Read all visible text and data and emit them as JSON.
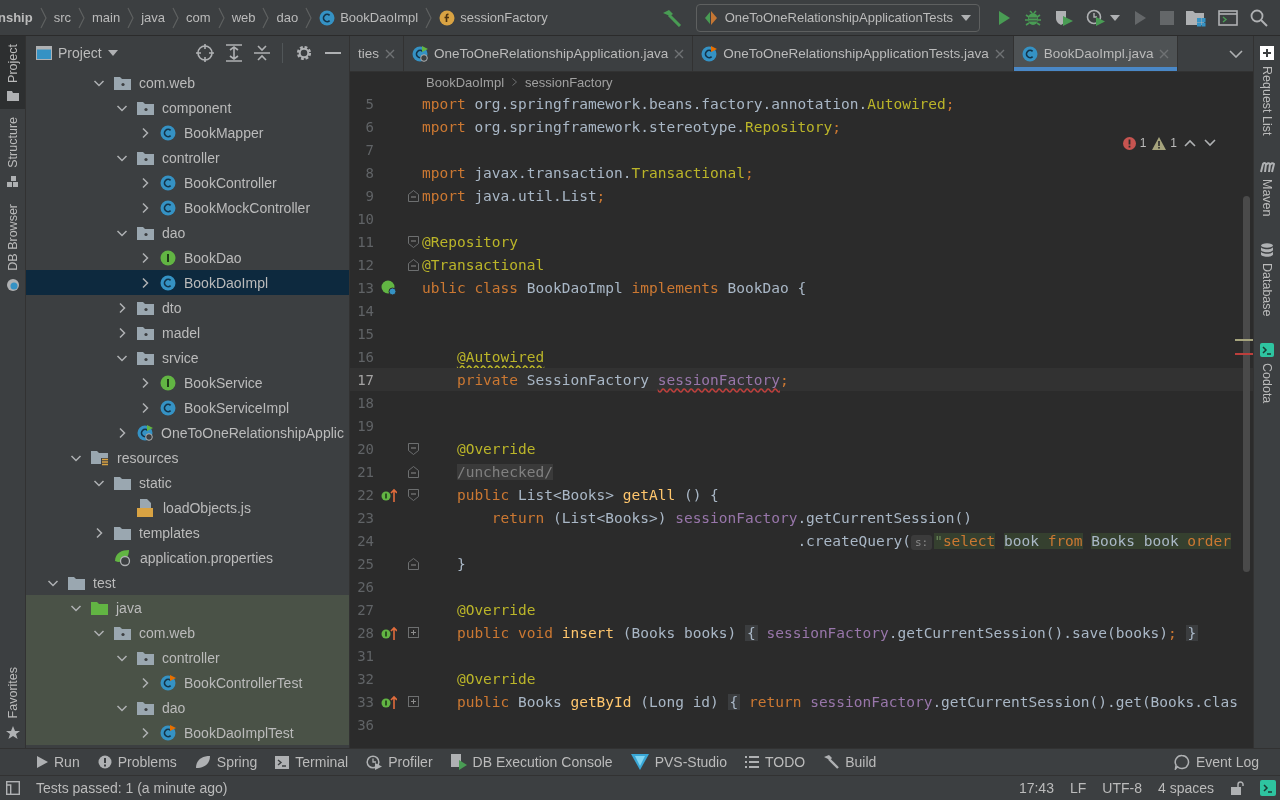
{
  "nav_bar": {
    "breadcrumbs": [
      {
        "label": "nship",
        "kind": "project"
      },
      {
        "label": "src",
        "kind": "dir"
      },
      {
        "label": "main",
        "kind": "dir"
      },
      {
        "label": "java",
        "kind": "dir"
      },
      {
        "label": "com",
        "kind": "dir"
      },
      {
        "label": "web",
        "kind": "dir"
      },
      {
        "label": "dao",
        "kind": "dir"
      },
      {
        "label": "BookDaoImpl",
        "kind": "class"
      },
      {
        "label": "sessionFactory",
        "kind": "field"
      }
    ],
    "run_config": "OneToOneRelationshipApplicationTests",
    "actions": [
      {
        "kind": "run",
        "disabled": false
      },
      {
        "kind": "debug",
        "disabled": false
      },
      {
        "kind": "coverage",
        "disabled": false
      },
      {
        "kind": "profile",
        "disabled": false
      },
      {
        "kind": "rerun",
        "disabled": true
      },
      {
        "kind": "stop",
        "disabled": true
      },
      {
        "kind": "structure",
        "disabled": false
      },
      {
        "kind": "layout",
        "disabled": false
      },
      {
        "kind": "search",
        "disabled": false
      }
    ]
  },
  "left_strip": {
    "top": [
      {
        "label": "Project",
        "kind": "project",
        "selected": true
      },
      {
        "label": "Structure",
        "kind": "structure",
        "selected": false
      },
      {
        "label": "DB Browser",
        "kind": "db",
        "selected": false
      }
    ],
    "bottom": [
      {
        "label": "Favorites",
        "kind": "favorites",
        "selected": false
      }
    ]
  },
  "project_panel": {
    "title": "Project",
    "tree": [
      {
        "children": [
          {
            "children": [
              {
                "label": "com.web",
                "kind": "package",
                "expanded": true,
                "selected": false,
                "children": [
                  {
                    "label": "component",
                    "kind": "package",
                    "expanded": true,
                    "selected": false,
                    "children": [
                      {
                        "label": "BookMapper",
                        "kind": "class",
                        "expanded": false,
                        "selected": false
                      }
                    ]
                  },
                  {
                    "label": "controller",
                    "kind": "package",
                    "expanded": true,
                    "selected": false,
                    "children": [
                      {
                        "label": "BookController",
                        "kind": "class",
                        "expanded": false,
                        "selected": false
                      },
                      {
                        "label": "BookMockController",
                        "kind": "class",
                        "expanded": false,
                        "selected": false
                      }
                    ]
                  },
                  {
                    "label": "dao",
                    "kind": "package",
                    "expanded": true,
                    "selected": false,
                    "children": [
                      {
                        "label": "BookDao",
                        "kind": "interface",
                        "expanded": false,
                        "selected": false
                      },
                      {
                        "label": "BookDaoImpl",
                        "kind": "class",
                        "expanded": false,
                        "selected": true
                      }
                    ]
                  },
                  {
                    "label": "dto",
                    "kind": "package",
                    "expanded": false,
                    "selected": false
                  },
                  {
                    "label": "madel",
                    "kind": "package",
                    "expanded": false,
                    "selected": false
                  },
                  {
                    "label": "srvice",
                    "kind": "package",
                    "expanded": true,
                    "selected": false,
                    "children": [
                      {
                        "label": "BookService",
                        "kind": "interface",
                        "expanded": false,
                        "selected": false
                      },
                      {
                        "label": "BookServiceImpl",
                        "kind": "class",
                        "expanded": false,
                        "selected": false
                      }
                    ]
                  },
                  {
                    "label": "OneToOneRelationshipApplic",
                    "kind": "app",
                    "expanded": false,
                    "selected": false
                  }
                ]
              }
            ]
          },
          {
            "label": "resources",
            "kind": "resources",
            "expanded": true,
            "selected": false,
            "children": [
              {
                "label": "static",
                "kind": "folder",
                "expanded": true,
                "selected": false,
                "children": [
                  {
                    "label": "loadObjects.js",
                    "kind": "js",
                    "selected": false
                  }
                ]
              },
              {
                "label": "templates",
                "kind": "folder",
                "expanded": false,
                "selected": false
              },
              {
                "label": "application.properties",
                "kind": "properties",
                "selected": false
              }
            ]
          }
        ]
      },
      {
        "label": "test",
        "kind": "folder",
        "expanded": true,
        "selected": false,
        "children": [
          {
            "label": "java",
            "kind": "test-root",
            "expanded": true,
            "selected": false,
            "children": [
              {
                "label": "com.web",
                "kind": "package",
                "expanded": true,
                "selected": false,
                "children": [
                  {
                    "label": "controller",
                    "kind": "package",
                    "expanded": true,
                    "selected": false,
                    "children": [
                      {
                        "label": "BookControllerTest",
                        "kind": "test-class",
                        "expanded": false,
                        "selected": false
                      }
                    ]
                  },
                  {
                    "label": "dao",
                    "kind": "package",
                    "expanded": true,
                    "selected": false,
                    "children": [
                      {
                        "label": "BookDaoImplTest",
                        "kind": "test-class",
                        "expanded": false,
                        "selected": false
                      }
                    ]
                  }
                ]
              }
            ]
          }
        ]
      }
    ]
  },
  "editor": {
    "tabs": [
      {
        "label": "ties",
        "selected": false
      },
      {
        "label": "OneToOneRelationshipApplication.java",
        "kind": "app",
        "selected": false
      },
      {
        "label": "OneToOneRelationshipApplicationTests.java",
        "kind": "test-class",
        "selected": false
      },
      {
        "label": "BookDaoImpl.java",
        "kind": "class",
        "selected": true
      }
    ],
    "breadcrumb": [
      "BookDaoImpl",
      "sessionFactory"
    ],
    "inspections": {
      "errors": "1",
      "warnings": "1"
    },
    "lines": [
      {
        "number": "5",
        "current": false,
        "tokens": [
          {
            "text": "mport ",
            "kind": "kw"
          },
          {
            "text": "org.springframework.beans.factory.annotation.",
            "kind": "plain"
          },
          {
            "text": "Autowired",
            "kind": "ann"
          },
          {
            "text": ";",
            "kind": "kw"
          }
        ]
      },
      {
        "number": "6",
        "current": false,
        "tokens": [
          {
            "text": "mport ",
            "kind": "kw"
          },
          {
            "text": "org.springframework.stereotype.",
            "kind": "plain"
          },
          {
            "text": "Repository",
            "kind": "ann"
          },
          {
            "text": ";",
            "kind": "kw"
          }
        ]
      },
      {
        "number": "7",
        "current": false
      },
      {
        "number": "8",
        "current": false,
        "tokens": [
          {
            "text": "mport ",
            "kind": "kw"
          },
          {
            "text": "javax.transaction.",
            "kind": "plain"
          },
          {
            "text": "Transactional",
            "kind": "ann"
          },
          {
            "text": ";",
            "kind": "kw"
          }
        ]
      },
      {
        "number": "9",
        "current": false,
        "markers": [
          {
            "kind": "fold-end"
          }
        ],
        "tokens": [
          {
            "text": "mport ",
            "kind": "kw"
          },
          {
            "text": "java.util.List",
            "kind": "plain"
          },
          {
            "text": ";",
            "kind": "kw"
          }
        ]
      },
      {
        "number": "10",
        "current": false
      },
      {
        "number": "11",
        "current": false,
        "markers": [
          {
            "kind": "fold-start"
          }
        ],
        "tokens": [
          {
            "text": "@Repository",
            "kind": "ann"
          }
        ]
      },
      {
        "number": "12",
        "current": false,
        "markers": [
          {
            "kind": "fold-end"
          }
        ],
        "tokens": [
          {
            "text": "@Transactional",
            "kind": "ann"
          }
        ]
      },
      {
        "number": "13",
        "current": false,
        "markers": [
          {
            "kind": "bean"
          }
        ],
        "tokens": [
          {
            "text": "ublic class ",
            "kind": "kw"
          },
          {
            "text": "BookDaoImpl ",
            "kind": "plain"
          },
          {
            "text": "implements ",
            "kind": "kw"
          },
          {
            "text": "BookDao {",
            "kind": "plain"
          }
        ]
      },
      {
        "number": "14",
        "current": false
      },
      {
        "number": "15",
        "current": false
      },
      {
        "number": "16",
        "current": false,
        "tokens": [
          {
            "text": "    @Autowired",
            "kind": "ann-warn"
          }
        ]
      },
      {
        "number": "17",
        "current": true,
        "tokens": [
          {
            "text": "    private ",
            "kind": "kw"
          },
          {
            "text": "SessionFactory ",
            "kind": "plain"
          },
          {
            "text": "sessionFactory",
            "kind": "field-err"
          },
          {
            "text": ";",
            "kind": "kw"
          }
        ]
      },
      {
        "number": "18",
        "current": false
      },
      {
        "number": "19",
        "current": false
      },
      {
        "number": "20",
        "current": false,
        "markers": [
          {
            "kind": "fold-start"
          }
        ],
        "tokens": [
          {
            "text": "    @Override",
            "kind": "ann"
          }
        ]
      },
      {
        "number": "21",
        "current": false,
        "markers": [
          {
            "kind": "fold-end"
          }
        ],
        "tokens": [
          {
            "text": "    /unchecked/",
            "kind": "comment"
          }
        ]
      },
      {
        "number": "22",
        "current": false,
        "markers": [
          {
            "kind": "implements"
          },
          {
            "kind": "fold-start"
          }
        ],
        "tokens": [
          {
            "text": "    public ",
            "kind": "kw"
          },
          {
            "text": "List<Books> ",
            "kind": "plain"
          },
          {
            "text": "getAll",
            "kind": "method"
          },
          {
            "text": " () {",
            "kind": "plain"
          }
        ]
      },
      {
        "number": "23",
        "current": false,
        "tokens": [
          {
            "text": "        return ",
            "kind": "kw"
          },
          {
            "text": "(List<Books>) ",
            "kind": "plain"
          },
          {
            "text": "sessionFactory",
            "kind": "field"
          },
          {
            "text": ".getCurrentSession()",
            "kind": "plain"
          }
        ]
      },
      {
        "number": "24",
        "current": false,
        "tokens": [
          {
            "text": "                                           .createQuery(",
            "kind": "plain"
          },
          {
            "text": "s:",
            "kind": "hint"
          },
          {
            "text": "\"",
            "kind": "quote"
          },
          {
            "text": "select",
            "kind": "sql-kw"
          },
          {
            "text": " book ",
            "kind": "sql"
          },
          {
            "text": "from",
            "kind": "sql-kw"
          },
          {
            "text": " Books book ",
            "kind": "sql"
          },
          {
            "text": "order",
            "kind": "sql-kw"
          }
        ]
      },
      {
        "number": "25",
        "current": false,
        "markers": [
          {
            "kind": "fold-end"
          }
        ],
        "tokens": [
          {
            "text": "    }",
            "kind": "plain"
          }
        ]
      },
      {
        "number": "26",
        "current": false
      },
      {
        "number": "27",
        "current": false,
        "tokens": [
          {
            "text": "    @Override",
            "kind": "ann"
          }
        ]
      },
      {
        "number": "28",
        "current": false,
        "markers": [
          {
            "kind": "implements"
          },
          {
            "kind": "fold-collapsed"
          }
        ],
        "tokens": [
          {
            "text": "    public void ",
            "kind": "kw"
          },
          {
            "text": "insert",
            "kind": "method"
          },
          {
            "text": " (Books books) ",
            "kind": "plain"
          },
          {
            "text": "{",
            "kind": "folded"
          },
          {
            "text": " sessionFactory",
            "kind": "field"
          },
          {
            "text": ".getCurrentSession().save(books)",
            "kind": "plain"
          },
          {
            "text": ";",
            "kind": "kw"
          },
          {
            "text": " }",
            "kind": "folded"
          }
        ]
      },
      {
        "number": "31",
        "current": false
      },
      {
        "number": "32",
        "current": false,
        "tokens": [
          {
            "text": "    @Override",
            "kind": "ann"
          }
        ]
      },
      {
        "number": "33",
        "current": false,
        "markers": [
          {
            "kind": "implements"
          },
          {
            "kind": "fold-collapsed"
          }
        ],
        "tokens": [
          {
            "text": "    public ",
            "kind": "kw"
          },
          {
            "text": "Books ",
            "kind": "plain"
          },
          {
            "text": "getById",
            "kind": "method"
          },
          {
            "text": " (Long id) ",
            "kind": "plain"
          },
          {
            "text": "{",
            "kind": "folded"
          },
          {
            "text": " return ",
            "kind": "kw"
          },
          {
            "text": "sessionFactory",
            "kind": "field"
          },
          {
            "text": ".getCurrentSession().get(Books.clas",
            "kind": "plain"
          }
        ]
      },
      {
        "number": "36",
        "current": false
      }
    ]
  },
  "right_strip": [
    {
      "label": "Request List",
      "kind": "request"
    },
    {
      "label": "Maven",
      "kind": "maven"
    },
    {
      "label": "Database",
      "kind": "database"
    },
    {
      "label": "Codota",
      "kind": "codota"
    }
  ],
  "tool_windows": {
    "left": [
      {
        "label": "Run",
        "kind": "run"
      },
      {
        "label": "Problems",
        "kind": "problems"
      },
      {
        "label": "Spring",
        "kind": "spring"
      },
      {
        "label": "Terminal",
        "kind": "terminal"
      },
      {
        "label": "Profiler",
        "kind": "profiler"
      },
      {
        "label": "DB Execution Console",
        "kind": "db"
      },
      {
        "label": "PVS-Studio",
        "kind": "pvs"
      },
      {
        "label": "TODO",
        "kind": "todo"
      },
      {
        "label": "Build",
        "kind": "build"
      }
    ],
    "right": [
      {
        "label": "Event Log",
        "kind": "log"
      }
    ]
  },
  "status_bar": {
    "message": "Tests passed: 1 (a minute ago)",
    "items": [
      "17:43",
      "LF",
      "UTF-8",
      "4 spaces"
    ]
  }
}
